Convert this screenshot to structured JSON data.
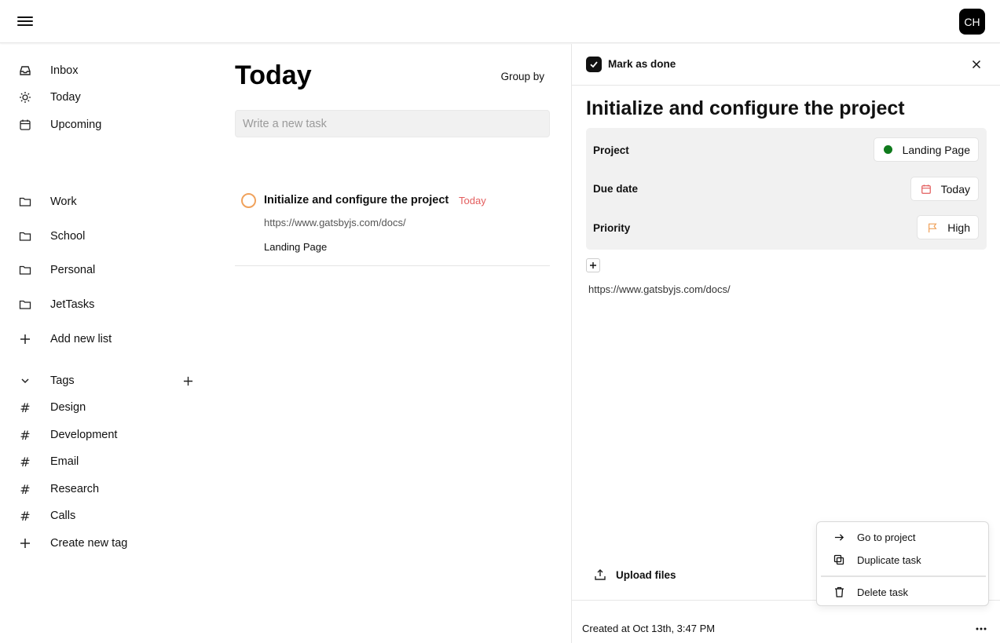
{
  "header": {
    "avatar_initials": "CH"
  },
  "sidebar": {
    "nav": [
      {
        "label": "Inbox",
        "icon": "inbox-icon"
      },
      {
        "label": "Today",
        "icon": "sun-icon"
      },
      {
        "label": "Upcoming",
        "icon": "calendar-icon"
      }
    ],
    "lists": [
      {
        "label": "Work",
        "icon": "folder-icon"
      },
      {
        "label": "School",
        "icon": "folder-icon"
      },
      {
        "label": "Personal",
        "icon": "folder-icon"
      },
      {
        "label": "JetTasks",
        "icon": "folder-icon"
      }
    ],
    "add_list_label": "Add new list",
    "tags_header": "Tags",
    "tags": [
      {
        "label": "Design",
        "icon": "hash-icon"
      },
      {
        "label": "Development",
        "icon": "hash-icon"
      },
      {
        "label": "Email",
        "icon": "hash-icon"
      },
      {
        "label": "Research",
        "icon": "hash-icon"
      },
      {
        "label": "Calls",
        "icon": "hash-icon"
      }
    ],
    "create_tag_label": "Create new tag"
  },
  "main": {
    "title": "Today",
    "group_by_label": "Group by",
    "new_task_placeholder": "Write a new task",
    "tasks": [
      {
        "title": "Initialize and configure the project",
        "due": "Today",
        "link": "https://www.gatsbyjs.com/docs/",
        "project": "Landing Page"
      }
    ]
  },
  "detail": {
    "mark_done_label": "Mark as done",
    "title": "Initialize and configure the project",
    "properties": {
      "project_label": "Project",
      "project_value": "Landing Page",
      "project_color": "#0f7a1c",
      "due_label": "Due date",
      "due_value": "Today",
      "priority_label": "Priority",
      "priority_value": "High"
    },
    "link": "https://www.gatsbyjs.com/docs/",
    "upload_label": "Upload files",
    "created_text": "Created at Oct 13th, 3:47 PM"
  },
  "context_menu": {
    "items": [
      {
        "label": "Go to project",
        "icon": "arrow-right-icon"
      },
      {
        "label": "Duplicate task",
        "icon": "copy-icon"
      },
      {
        "label": "Delete task",
        "icon": "trash-icon"
      }
    ]
  },
  "colors": {
    "accent_dark": "#000000",
    "due_today": "#e35d5d",
    "task_circle": "#f0a25c",
    "priority_high": "#f0a25c",
    "calendar_icon": "#e35d5d"
  }
}
